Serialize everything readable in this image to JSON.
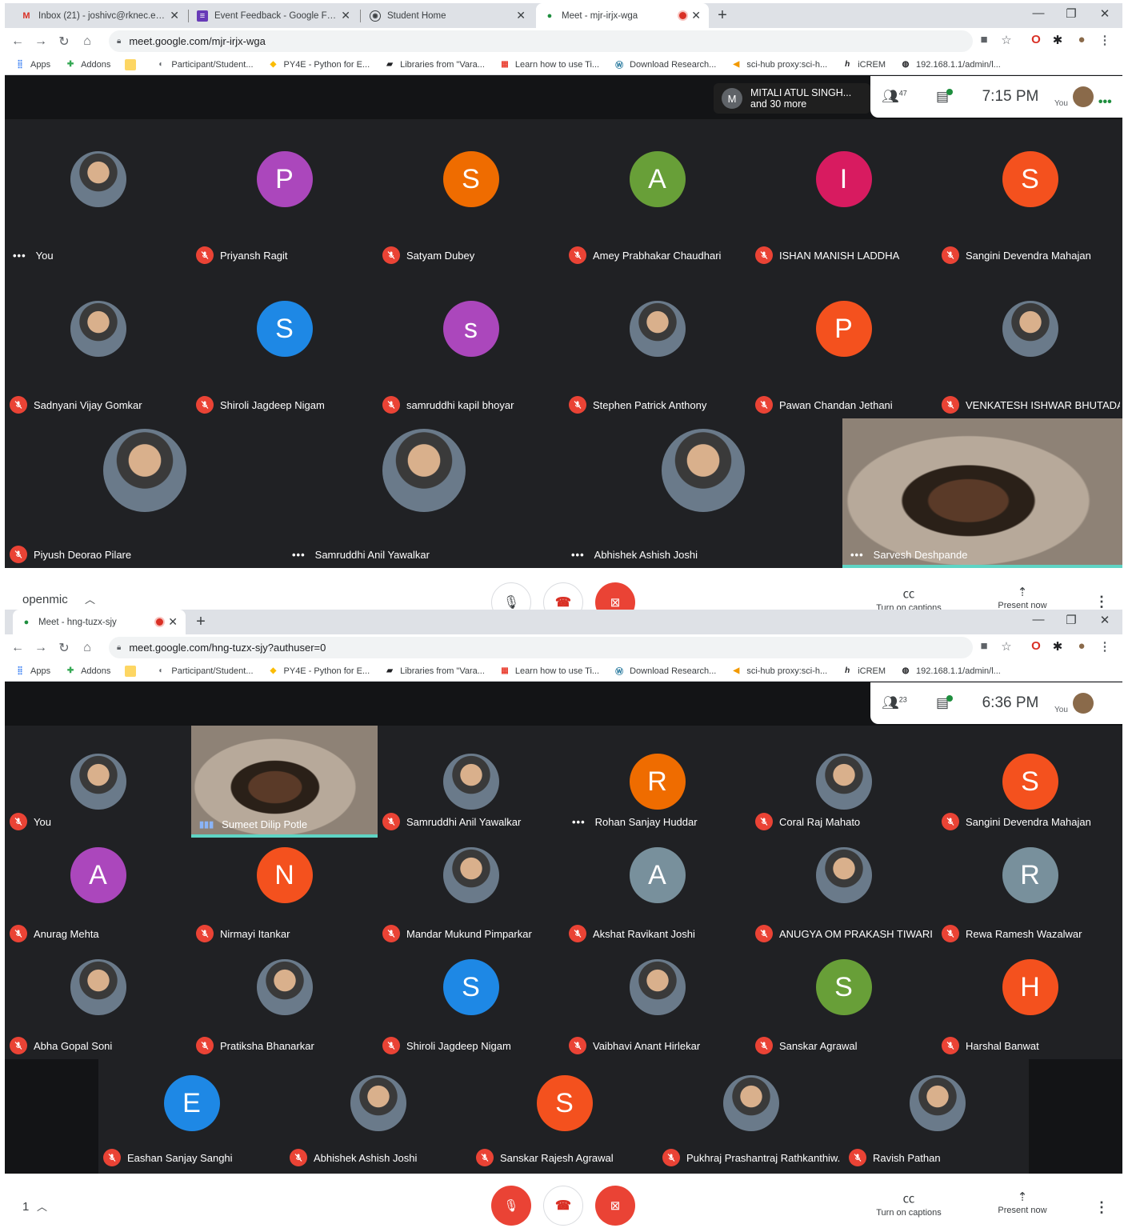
{
  "window1": {
    "tabs": [
      {
        "label": "Inbox (21) - joshivc@rknec.edu",
        "icon": "gmail-icon"
      },
      {
        "label": "Event Feedback - Google Forms",
        "icon": "forms-icon"
      },
      {
        "label": "Student Home",
        "icon": "student-home-icon"
      },
      {
        "label": "Meet - mjr-irjx-wga",
        "icon": "meet-icon",
        "active": true
      }
    ],
    "url": "meet.google.com/mjr-irjx-wga",
    "presenter": {
      "initial": "M",
      "line1": "MITALI ATUL SINGH...",
      "line2": "and 30 more"
    },
    "people_count": "47",
    "clock": "7:15 PM",
    "you_label": "You",
    "participants": [
      {
        "name": "You",
        "status": "speaking-dots",
        "avatar": "photo"
      },
      {
        "name": "Priyansh Ragit",
        "status": "muted",
        "initial": "P",
        "color": "#ab47bc"
      },
      {
        "name": "Satyam Dubey",
        "status": "muted",
        "initial": "S",
        "color": "#ef6c00"
      },
      {
        "name": "Amey Prabhakar Chaudhari",
        "status": "muted",
        "initial": "A",
        "color": "#689f38"
      },
      {
        "name": "ISHAN MANISH LADDHA",
        "status": "muted",
        "initial": "I",
        "color": "#d81b60"
      },
      {
        "name": "Sangini Devendra Mahajan",
        "status": "muted",
        "initial": "S",
        "color": "#f4511e"
      },
      {
        "name": "Sadnyani Vijay Gomkar",
        "status": "muted",
        "avatar": "photo"
      },
      {
        "name": "Shiroli Jagdeep Nigam",
        "status": "muted",
        "initial": "S",
        "color": "#1e88e5"
      },
      {
        "name": "samruddhi kapil bhoyar",
        "status": "muted",
        "initial": "s",
        "color": "#ab47bc"
      },
      {
        "name": "Stephen Patrick Anthony",
        "status": "muted",
        "avatar": "photo"
      },
      {
        "name": "Pawan Chandan Jethani",
        "status": "muted",
        "initial": "P",
        "color": "#f4511e"
      },
      {
        "name": "VENKATESH ISHWAR BHUTADA",
        "status": "muted",
        "avatar": "photo"
      },
      {
        "name": "Piyush Deorao Pilare",
        "status": "muted",
        "avatar": "photo"
      },
      {
        "name": "Samruddhi Anil Yawalkar",
        "status": "speaking-dots",
        "avatar": "photo"
      },
      {
        "name": "Abhishek Ashish Joshi",
        "status": "speaking-dots",
        "avatar": "photo"
      },
      {
        "name": "Sarvesh Deshpande",
        "status": "speaking-dots",
        "avatar": "video"
      }
    ],
    "bottom_left": "openmic",
    "captions_label": "Turn on captions",
    "present_label": "Present now"
  },
  "window2": {
    "tabs": [
      {
        "label": "Meet - hng-tuzx-sjy",
        "icon": "meet-icon",
        "active": true
      }
    ],
    "url": "meet.google.com/hng-tuzx-sjy?authuser=0",
    "people_count": "23",
    "clock": "6:36 PM",
    "you_label": "You",
    "participants": [
      {
        "name": "You",
        "status": "muted",
        "avatar": "photo"
      },
      {
        "name": "Sumeet Dilip Potle",
        "status": "speaking",
        "avatar": "video"
      },
      {
        "name": "Samruddhi Anil Yawalkar",
        "status": "muted",
        "avatar": "photo"
      },
      {
        "name": "Rohan Sanjay Huddar",
        "status": "speaking-dots",
        "initial": "R",
        "color": "#ef6c00"
      },
      {
        "name": "Coral Raj Mahato",
        "status": "muted",
        "avatar": "photo"
      },
      {
        "name": "Sangini Devendra Mahajan",
        "status": "muted",
        "initial": "S",
        "color": "#f4511e"
      },
      {
        "name": "Anurag Mehta",
        "status": "muted",
        "initial": "A",
        "color": "#ab47bc"
      },
      {
        "name": "Nirmayi Itankar",
        "status": "muted",
        "initial": "N",
        "color": "#f4511e"
      },
      {
        "name": "Mandar Mukund Pimparkar",
        "status": "muted",
        "avatar": "photo"
      },
      {
        "name": "Akshat Ravikant Joshi",
        "status": "muted",
        "initial": "A",
        "color": "#78909c"
      },
      {
        "name": "ANUGYA OM PRAKASH TIWARI",
        "status": "muted",
        "avatar": "photo"
      },
      {
        "name": "Rewa Ramesh Wazalwar",
        "status": "muted",
        "initial": "R",
        "color": "#78909c"
      },
      {
        "name": "Abha Gopal Soni",
        "status": "muted",
        "avatar": "photo"
      },
      {
        "name": "Pratiksha Bhanarkar",
        "status": "muted",
        "avatar": "photo"
      },
      {
        "name": "Shiroli Jagdeep Nigam",
        "status": "muted",
        "initial": "S",
        "color": "#1e88e5"
      },
      {
        "name": "Vaibhavi Anant Hirlekar",
        "status": "muted",
        "avatar": "photo"
      },
      {
        "name": "Sanskar Agrawal",
        "status": "muted",
        "initial": "S",
        "color": "#689f38"
      },
      {
        "name": "Harshal Banwat",
        "status": "muted",
        "initial": "H",
        "color": "#f4511e"
      },
      {
        "name": "Eashan Sanjay Sanghi",
        "status": "muted",
        "initial": "E",
        "color": "#1e88e5"
      },
      {
        "name": "Abhishek Ashish Joshi",
        "status": "muted",
        "avatar": "photo"
      },
      {
        "name": "Sanskar Rajesh Agrawal",
        "status": "muted",
        "initial": "S",
        "color": "#f4511e"
      },
      {
        "name": "Pukhraj Prashantraj Rathkanthiw...",
        "status": "muted",
        "avatar": "photo"
      },
      {
        "name": "Ravish Pathan",
        "status": "muted",
        "avatar": "photo"
      }
    ],
    "bottom_left": "1",
    "captions_label": "Turn on captions",
    "present_label": "Present now"
  },
  "bookmarks": [
    {
      "label": "Apps",
      "icon": "apps-grid-icon"
    },
    {
      "label": "Addons",
      "icon": "puzzle-icon"
    },
    {
      "label": "",
      "icon": "folder-icon"
    },
    {
      "label": "Participant/Student...",
      "icon": "site-icon"
    },
    {
      "label": "PY4E - Python for E...",
      "icon": "python-icon"
    },
    {
      "label": "Libraries from \"Vara...",
      "icon": "library-icon"
    },
    {
      "label": "Learn how to use Ti...",
      "icon": "tile-icon"
    },
    {
      "label": "Download Research...",
      "icon": "wordpress-icon"
    },
    {
      "label": "sci-hub proxy:sci-h...",
      "icon": "bird-icon"
    },
    {
      "label": "iCREM",
      "icon": "h-icon"
    },
    {
      "label": "192.168.1.1/admin/l...",
      "icon": "globe-icon"
    }
  ]
}
